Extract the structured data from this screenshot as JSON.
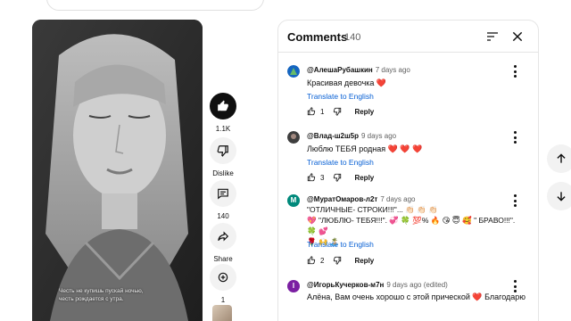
{
  "video": {
    "caption_lines": [
      "Честь не купишь пускай ночью,",
      "честь рождается с утра."
    ]
  },
  "actions": {
    "like_count": "1.1K",
    "dislike_label": "Dislike",
    "comment_count": "140",
    "share_label": "Share",
    "remix_count": "1"
  },
  "comments_panel": {
    "title": "Comments",
    "count": "140",
    "comments": [
      {
        "author": "@АлешаРубашкин",
        "time": "7 days ago",
        "text": "Красивая девочка ❤️",
        "translate": "Translate to English",
        "likes": "1",
        "reply": "Reply",
        "avatar_color": "#2e7d32"
      },
      {
        "author": "@Влад-ш2ш5р",
        "time": "9 days ago",
        "text": "Люблю ТЕБЯ родная ❤️ ❤️ ❤️",
        "translate": "Translate to English",
        "likes": "3",
        "reply": "Reply",
        "avatar_color": "#5d4037"
      },
      {
        "author": "@МуратОмаров-л2т",
        "time": "7 days ago",
        "text_line1": "\"ОТЛИЧНЫЕ- СТРОКИ!!!\"... 👏🏻 👏🏻 👏🏻",
        "text_line2": "💖 \"ЛЮБЛЮ- ТЕБЯ!!!\". 💞 🍀 💯% 🔥 😘 😇 🥰 \" БРАВО!!!\". 🍀 💕",
        "text_line3": "🌹 🙌 🏝️",
        "translate": "Translate to English",
        "likes": "2",
        "reply": "Reply",
        "avatar_color": "#00897b"
      },
      {
        "author": "@ИгорьКучерков-м7н",
        "time": "9 days ago (edited)",
        "text": "Алёна, Вам очень хорошо с этой прической ❤️ Благодарю за",
        "avatar_color": "#7b1fa2"
      }
    ]
  }
}
